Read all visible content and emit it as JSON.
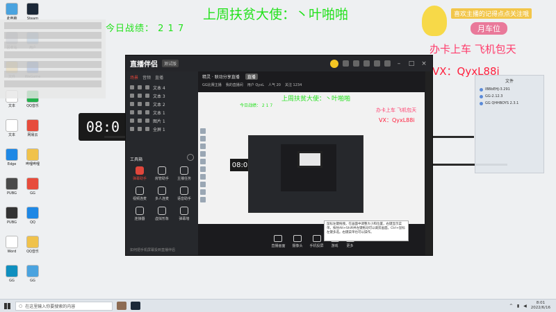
{
  "overlays": {
    "week_champion": "上周扶贫大使：丶叶啪啪",
    "today_score": "今日战绩： 2 1 7",
    "card_promo": "办卡上车  飞机包天",
    "vx": "VX：QyxL88i",
    "pin_note": "喜欢主播的记得点点关注哦",
    "badge": "月车位",
    "clock": "08:0"
  },
  "desktop_icons": [
    {
      "label": "此电脑",
      "color": "#4aa3df"
    },
    {
      "label": "Steam",
      "color": "#1b2838"
    },
    {
      "label": "回收站",
      "color": "#9aa7b4"
    },
    {
      "label": "用户",
      "color": "#6aa0d6"
    },
    {
      "label": "文件",
      "color": "#f0c24b"
    },
    {
      "label": "WeGame",
      "color": "#2c6ad6"
    },
    {
      "label": "文本",
      "color": "#ffffff"
    },
    {
      "label": "QQ音乐",
      "color": "#22b14c"
    },
    {
      "label": "文本",
      "color": "#ffffff"
    },
    {
      "label": "网易云",
      "color": "#e74c3c"
    },
    {
      "label": "Edge",
      "color": "#1e88e5"
    },
    {
      "label": "哔哩哔哩",
      "color": "#f0c24b"
    },
    {
      "label": "PUBG",
      "color": "#4a4a4a"
    },
    {
      "label": "GG",
      "color": "#e74c3c"
    },
    {
      "label": "PUBG",
      "color": "#333333"
    },
    {
      "label": "QQ",
      "color": "#1e88e5"
    },
    {
      "label": "Word",
      "color": "#ffffff"
    },
    {
      "label": "QQ音乐",
      "color": "#f0c24b"
    },
    {
      "label": "GG",
      "color": "#0f8fbf"
    },
    {
      "label": "GG",
      "color": "#4aa3df"
    }
  ],
  "right_panel": {
    "title": "文件",
    "rows": [
      "IBBbEHJ-3.291",
      "GG-2.12.3",
      "GG QHHBOYS 2.3.1"
    ]
  },
  "app": {
    "name": "直播伴侣",
    "version": "测试版",
    "sidebar_tabs": [
      "场景",
      "音频",
      "直播"
    ],
    "sources": [
      "文本 4",
      "文本 3",
      "文本 2",
      "文本 1",
      "图片 1",
      "全屏 1"
    ],
    "tools_title": "工具箱",
    "tools": [
      {
        "label": "弹幕助手",
        "primary": true
      },
      {
        "label": "房管助手",
        "primary": false
      },
      {
        "label": "主播任务",
        "primary": false
      },
      {
        "label": "视频连麦",
        "primary": false
      },
      {
        "label": "多人连麦",
        "primary": false
      },
      {
        "label": "语音助手",
        "primary": false
      },
      {
        "label": "连接器",
        "primary": false
      },
      {
        "label": "虚拟形象",
        "primary": false
      },
      {
        "label": "弹幕墙",
        "primary": false
      }
    ],
    "sb_bottom": "如何把手机屏幕投到直播伴侣",
    "info_title": "精灵 · 联动分享直播",
    "info_tag": "直播",
    "info2": [
      "GG比赛主播",
      "我的直播间",
      "用户 QyxL",
      "人气 20",
      "关注 1234"
    ],
    "preview": {
      "week": "上周扶贫大使：丶叶啪啪",
      "today": "今日战绩： 2 1 7",
      "promo": "办卡上车  飞机包天",
      "vx": "VX：QyxL88i",
      "clock": "08:0"
    },
    "bottom_tools": [
      "直播画面",
      "摄像头",
      "手机投屏",
      "游戏",
      "更多"
    ],
    "tooltip": "鼠标左键拖拽，在画面中调整大小和位置，右键显示菜单。按住Alt+Shift并左键拖动可以裁剪画面。Ctrl+鼠标左键多选。右键菜单也可以操作。"
  },
  "taskbar": {
    "search_placeholder": "在这里输入你要搜索的内容",
    "time": "8:01",
    "date": "2022/6/16"
  }
}
